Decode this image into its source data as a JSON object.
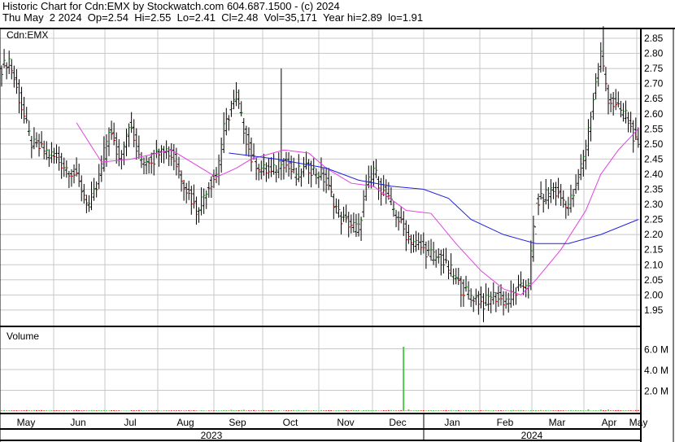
{
  "header": {
    "title": "Historic Chart for Cdn:EMX by Stockwatch.com 604.687.1500 - (c) 2024",
    "summary": "Thu May  2 2024  Op=2.54  Hi=2.55  Lo=2.41  Cl=2.48  Vol=35,171  Year hi=2.89  lo=1.91"
  },
  "colors": {
    "up": "#00a000",
    "down": "#d00000",
    "ma_short": "#e040e0",
    "ma_long": "#2020e0",
    "volume_up": "#50c050",
    "volume_down": "#e02020",
    "grid": "#c8c8c8"
  },
  "chart_data": [
    {
      "type": "ohlc",
      "title": "Cdn:EMX",
      "ylim": [
        1.91,
        2.89
      ],
      "yticks": [
        "2.85",
        "2.80",
        "2.75",
        "2.70",
        "2.65",
        "2.60",
        "2.55",
        "2.50",
        "2.45",
        "2.40",
        "2.35",
        "2.30",
        "2.25",
        "2.20",
        "2.15",
        "2.10",
        "2.05",
        "2.00",
        "1.95"
      ],
      "close_keypoints": [
        [
          0,
          2.75
        ],
        [
          3,
          2.78
        ],
        [
          7,
          2.65
        ],
        [
          12,
          2.5
        ],
        [
          19,
          2.47
        ],
        [
          29,
          2.4
        ],
        [
          35,
          2.3
        ],
        [
          38,
          2.35
        ],
        [
          43,
          2.55
        ],
        [
          47,
          2.45
        ],
        [
          51,
          2.57
        ],
        [
          55,
          2.45
        ],
        [
          61,
          2.45
        ],
        [
          64,
          2.5
        ],
        [
          69,
          2.45
        ],
        [
          74,
          2.35
        ],
        [
          78,
          2.28
        ],
        [
          82,
          2.35
        ],
        [
          86,
          2.4
        ],
        [
          89,
          2.55
        ],
        [
          94,
          2.66
        ],
        [
          97,
          2.55
        ],
        [
          100,
          2.45
        ],
        [
          104,
          2.42
        ],
        [
          108,
          2.4
        ],
        [
          112,
          2.45
        ],
        [
          117,
          2.4
        ],
        [
          123,
          2.42
        ],
        [
          128,
          2.4
        ],
        [
          131,
          2.35
        ],
        [
          136,
          2.25
        ],
        [
          143,
          2.22
        ],
        [
          146,
          2.35
        ],
        [
          149,
          2.42
        ],
        [
          152,
          2.35
        ],
        [
          156,
          2.3
        ],
        [
          159,
          2.25
        ],
        [
          162,
          2.2
        ],
        [
          169,
          2.15
        ],
        [
          175,
          2.12
        ],
        [
          180,
          2.08
        ],
        [
          184,
          2.02
        ],
        [
          188,
          2.0
        ],
        [
          193,
          1.97
        ],
        [
          196,
          2.0
        ],
        [
          201,
          1.98
        ],
        [
          208,
          2.02
        ],
        [
          211,
          2.05
        ],
        [
          214,
          2.3
        ],
        [
          220,
          2.35
        ],
        [
          227,
          2.3
        ],
        [
          230,
          2.35
        ],
        [
          234,
          2.5
        ],
        [
          237,
          2.65
        ],
        [
          240,
          2.8
        ],
        [
          243,
          2.65
        ],
        [
          246,
          2.62
        ],
        [
          250,
          2.6
        ],
        [
          255,
          2.48
        ]
      ],
      "high_overrides": [
        [
          112,
          2.75
        ],
        [
          241,
          2.89
        ],
        [
          214,
          2.2
        ]
      ],
      "low_overrides": [
        [
          193,
          1.91
        ]
      ],
      "ma_short": [
        [
          30,
          2.57
        ],
        [
          40,
          2.44
        ],
        [
          52,
          2.45
        ],
        [
          68,
          2.48
        ],
        [
          78,
          2.43
        ],
        [
          86,
          2.39
        ],
        [
          94,
          2.42
        ],
        [
          100,
          2.45
        ],
        [
          113,
          2.48
        ],
        [
          123,
          2.47
        ],
        [
          130,
          2.42
        ],
        [
          140,
          2.37
        ],
        [
          149,
          2.36
        ],
        [
          162,
          2.28
        ],
        [
          172,
          2.27
        ],
        [
          182,
          2.17
        ],
        [
          192,
          2.08
        ],
        [
          201,
          2.02
        ],
        [
          208,
          2.0
        ],
        [
          214,
          2.05
        ],
        [
          224,
          2.15
        ],
        [
          234,
          2.28
        ],
        [
          240,
          2.4
        ],
        [
          247,
          2.48
        ],
        [
          255,
          2.55
        ]
      ],
      "ma_long": [
        [
          91,
          2.47
        ],
        [
          110,
          2.45
        ],
        [
          130,
          2.42
        ],
        [
          143,
          2.38
        ],
        [
          156,
          2.36
        ],
        [
          169,
          2.35
        ],
        [
          179,
          2.32
        ],
        [
          188,
          2.25
        ],
        [
          201,
          2.2
        ],
        [
          214,
          2.17
        ],
        [
          227,
          2.17
        ],
        [
          240,
          2.2
        ],
        [
          255,
          2.25
        ]
      ]
    },
    {
      "type": "bar",
      "title": "Volume",
      "ylim": [
        0,
        8000000
      ],
      "yticks": [
        "6.0 M",
        "4.0 M",
        "2.0 M"
      ],
      "baseline_volume": 60000,
      "spikes": [
        [
          161,
          6200000
        ],
        [
          163,
          150000
        ],
        [
          97,
          120000
        ],
        [
          92,
          110000
        ],
        [
          235,
          150000
        ],
        [
          240,
          130000
        ],
        [
          243,
          140000
        ],
        [
          205,
          100000
        ]
      ]
    }
  ],
  "x_axis": {
    "months": [
      "May",
      "Jun",
      "Jul",
      "Aug",
      "Sep",
      "Oct",
      "Nov",
      "Dec",
      "Jan",
      "Feb",
      "Mar",
      "Apr",
      "May"
    ],
    "years": [
      "2023",
      "2024"
    ]
  }
}
